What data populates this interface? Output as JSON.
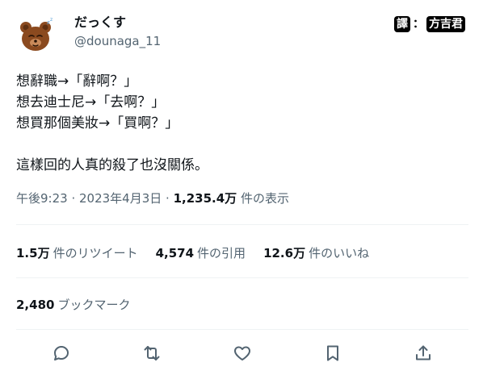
{
  "user": {
    "display_name": "だっくす",
    "handle": "@dounaga_11",
    "avatar_icon": "bear-face-icon"
  },
  "credit": {
    "left": "譯",
    "separator": "：",
    "right": "方吉君"
  },
  "tweet": {
    "text": "想辭職→「辭啊？」\n想去迪士尼→「去啊？」\n想買那個美妝→「買啊？」\n\n這樣回的人真的殺了也沒關係。"
  },
  "meta": {
    "time": "午後9:23",
    "sep1": " · ",
    "date": "2023年4月3日",
    "sep2": " · ",
    "views_count": "1,235.4万",
    "views_label": " 件の表示"
  },
  "stats": {
    "retweets_count": "1.5万",
    "retweets_label": "件のリツイート",
    "quotes_count": "4,574",
    "quotes_label": "件の引用",
    "likes_count": "12.6万",
    "likes_label": "件のいいね"
  },
  "bookmarks": {
    "count": "2,480",
    "label": "ブックマーク"
  },
  "actions": [
    {
      "name": "reply",
      "icon": "reply-icon"
    },
    {
      "name": "retweet",
      "icon": "retweet-icon"
    },
    {
      "name": "like",
      "icon": "heart-icon"
    },
    {
      "name": "bookmark",
      "icon": "bookmark-icon"
    },
    {
      "name": "share",
      "icon": "share-icon"
    }
  ],
  "colors": {
    "text": "#0f1419",
    "secondary": "#536471",
    "divider": "#eff3f4",
    "bear": "#8b4a1f"
  }
}
